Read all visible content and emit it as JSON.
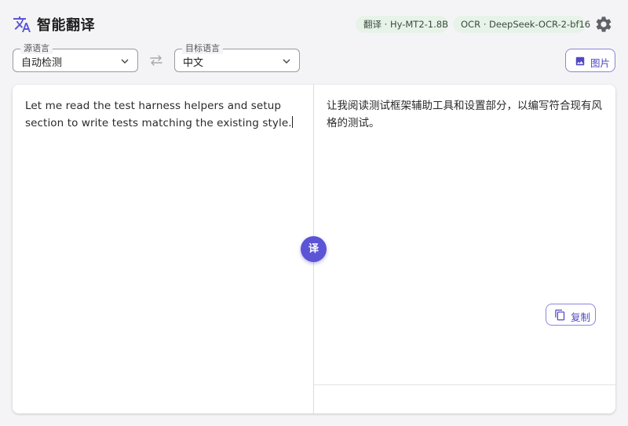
{
  "header": {
    "title": "智能翻译",
    "app_icon": "translate-icon",
    "chips": {
      "translate_model": "翻译 · Hy-MT2-1.8B",
      "ocr_model": "OCR · DeepSeek-OCR-2-bf16"
    },
    "settings_icon": "gear-icon"
  },
  "languages": {
    "source": {
      "legend": "源语言",
      "value": "自动检测"
    },
    "target": {
      "legend": "目标语言",
      "value": "中文"
    },
    "swap_icon": "swap-arrows-icon"
  },
  "image_button": {
    "label": "图片",
    "icon": "image-icon"
  },
  "editor": {
    "source_text": "Let me read the test harness helpers and setup section to write tests matching the existing style.",
    "translated_text": "让我阅读测试框架辅助工具和设置部分，以编写符合现有风格的测试。"
  },
  "translate_button": {
    "label": "译"
  },
  "copy_button": {
    "label": "复制",
    "icon": "copy-icon"
  },
  "colors": {
    "accent": "#5b54d6",
    "chip_bg": "#e7f3e8",
    "background": "#f4f4f6"
  }
}
